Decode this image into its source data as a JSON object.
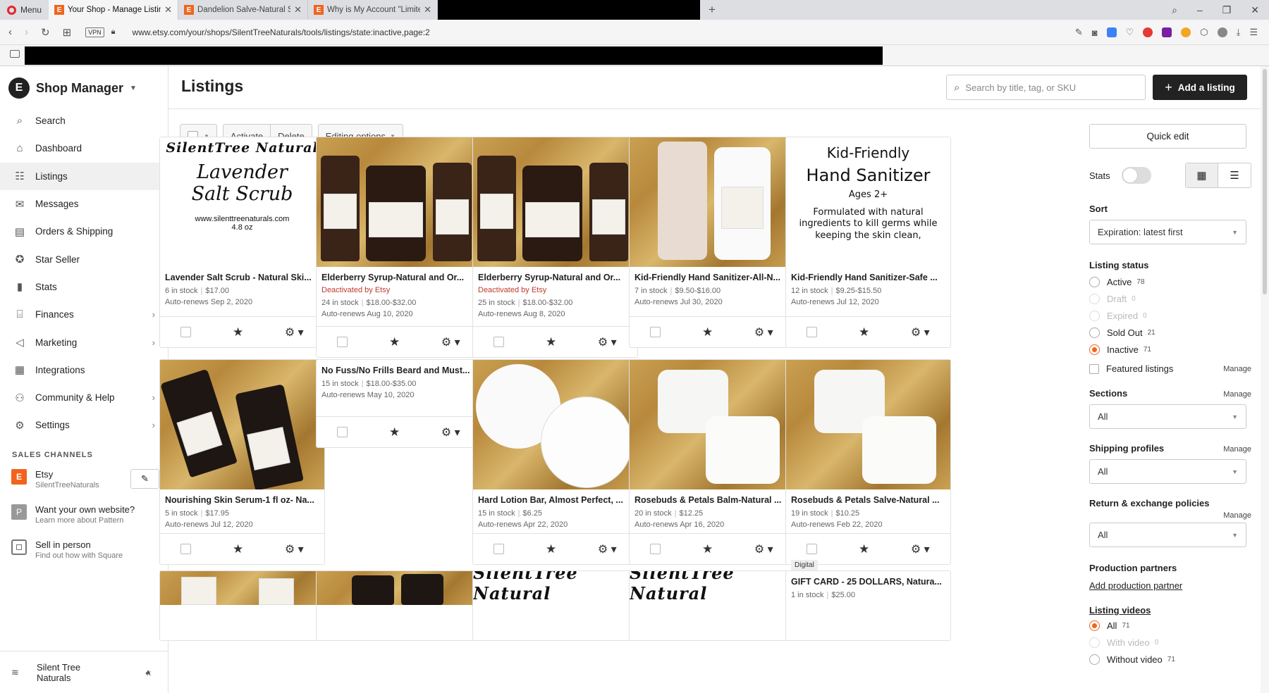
{
  "browser": {
    "menu_label": "Menu",
    "tabs": [
      {
        "title": "Your Shop - Manage Listing",
        "active": true
      },
      {
        "title": "Dandelion Salve-Natural St",
        "active": false
      },
      {
        "title": "Why is My Account \"Limited",
        "active": false
      }
    ],
    "url": "www.etsy.com/your/shops/SilentTreeNaturals/tools/listings/state:inactive,page:2",
    "vpn": "VPN"
  },
  "sidebar": {
    "title": "Shop Manager",
    "items": [
      {
        "label": "Search",
        "icon": "search-icon",
        "chev": false
      },
      {
        "label": "Dashboard",
        "icon": "home-icon",
        "chev": false
      },
      {
        "label": "Listings",
        "icon": "listings-icon",
        "chev": false,
        "active": true
      },
      {
        "label": "Messages",
        "icon": "mail-icon",
        "chev": false
      },
      {
        "label": "Orders & Shipping",
        "icon": "clipboard-icon",
        "chev": false
      },
      {
        "label": "Star Seller",
        "icon": "star-badge-icon",
        "chev": false
      },
      {
        "label": "Stats",
        "icon": "bar-chart-icon",
        "chev": false
      },
      {
        "label": "Finances",
        "icon": "bank-icon",
        "chev": true
      },
      {
        "label": "Marketing",
        "icon": "megaphone-icon",
        "chev": true
      },
      {
        "label": "Integrations",
        "icon": "grid-icon",
        "chev": false
      },
      {
        "label": "Community & Help",
        "icon": "people-icon",
        "chev": true
      },
      {
        "label": "Settings",
        "icon": "gear-icon",
        "chev": true
      }
    ],
    "sales_channels_title": "SALES CHANNELS",
    "channels": [
      {
        "name": "Etsy",
        "sub": "SilentTreeNaturals"
      },
      {
        "name": "Want your own website?",
        "sub": "Learn more about Pattern"
      },
      {
        "name": "Sell in person",
        "sub": "Find out how with Square"
      }
    ],
    "shop_name_line1": "Silent Tree",
    "shop_name_line2": "Naturals"
  },
  "header": {
    "title": "Listings",
    "search_placeholder": "Search by title, tag, or SKU",
    "add_label": "Add a listing"
  },
  "toolbar": {
    "activate": "Activate",
    "delete": "Delete",
    "editing": "Editing options"
  },
  "listings": [
    {
      "name": "Lavender Salt Scrub - Natural Ski...",
      "stock": "6 in stock",
      "price": "$17.00",
      "renew": "Auto-renews Sep 2, 2020",
      "deactivated": "",
      "img": "text",
      "img_lines": [
        "SilentTree Natural",
        "Lavender",
        "Salt Scrub",
        "www.silenttreenaturals.com",
        "4.8 oz"
      ]
    },
    {
      "name": "Elderberry Syrup-Natural and Or...",
      "stock": "24 in stock",
      "price": "$18.00-$32.00",
      "renew": "Auto-renews Aug 10, 2020",
      "deactivated": "Deactivated by Etsy",
      "img": "syrup"
    },
    {
      "name": "Elderberry Syrup-Natural and Or...",
      "stock": "25 in stock",
      "price": "$18.00-$32.00",
      "renew": "Auto-renews Aug 8, 2020",
      "deactivated": "Deactivated by Etsy",
      "img": "syrup"
    },
    {
      "name": "Kid-Friendly Hand Sanitizer-All-N...",
      "stock": "7 in stock",
      "price": "$9.50-$16.00",
      "renew": "Auto-renews Jul 30, 2020",
      "deactivated": "",
      "img": "sanitizer"
    },
    {
      "name": "Kid-Friendly Hand Sanitizer-Safe ...",
      "stock": "12 in stock",
      "price": "$9.25-$15.50",
      "renew": "Auto-renews Jul 12, 2020",
      "deactivated": "",
      "img": "text2",
      "img_lines": [
        "Kid-Friendly",
        "Hand Sanitizer",
        "Ages 2+",
        "Formulated with natural ingredients to kill germs while keeping the skin clean,"
      ]
    },
    {
      "name": "Nourishing Skin Serum-1 fl oz- Na...",
      "stock": "5 in stock",
      "price": "$17.95",
      "renew": "Auto-renews Jul 12, 2020",
      "deactivated": "",
      "img": "serum"
    },
    {
      "name": "No Fuss/No Frills Beard and Must...",
      "stock": "15 in stock",
      "price": "$18.00-$35.00",
      "renew": "Auto-renews May 10, 2020",
      "deactivated": "",
      "img": "none"
    },
    {
      "name": "Hard Lotion Bar, Almost Perfect, ...",
      "stock": "15 in stock",
      "price": "$6.25",
      "renew": "Auto-renews Apr 22, 2020",
      "deactivated": "",
      "img": "tins"
    },
    {
      "name": "Rosebuds & Petals Balm-Natural ...",
      "stock": "20 in stock",
      "price": "$12.25",
      "renew": "Auto-renews Apr 16, 2020",
      "deactivated": "",
      "img": "jars"
    },
    {
      "name": "Rosebuds & Petals Salve-Natural ...",
      "stock": "19 in stock",
      "price": "$10.25",
      "renew": "Auto-renews Feb 22, 2020",
      "deactivated": "",
      "img": "jars"
    },
    {
      "name": "",
      "img": "partial-straw"
    },
    {
      "name": "",
      "img": "partial-dark"
    },
    {
      "name": "",
      "img": "partial-text",
      "img_lines": [
        "SilentTree Natural"
      ]
    },
    {
      "name": "",
      "img": "partial-text",
      "img_lines": [
        "SilentTree Natural"
      ]
    },
    {
      "name": "GIFT CARD - 25 DOLLARS, Natura...",
      "stock": "1 in stock",
      "price": "$25.00",
      "img": "gift",
      "badge": "Digital"
    }
  ],
  "panel": {
    "quick_edit": "Quick edit",
    "stats_label": "Stats",
    "sort_title": "Sort",
    "sort_value": "Expiration: latest first",
    "status_title": "Listing status",
    "statuses": [
      {
        "label": "Active",
        "count": "78",
        "disabled": false,
        "on": false
      },
      {
        "label": "Draft",
        "count": "0",
        "disabled": true,
        "on": false
      },
      {
        "label": "Expired",
        "count": "0",
        "disabled": true,
        "on": false
      },
      {
        "label": "Sold Out",
        "count": "21",
        "disabled": false,
        "on": false
      },
      {
        "label": "Inactive",
        "count": "71",
        "disabled": false,
        "on": true
      }
    ],
    "featured": "Featured listings",
    "manage": "Manage",
    "sections_title": "Sections",
    "sections_value": "All",
    "shipping_title": "Shipping profiles",
    "shipping_value": "All",
    "returns_title": "Return & exchange policies",
    "returns_value": "All",
    "production_title": "Production partners",
    "production_link": "Add production partner",
    "videos_title": "Listing videos",
    "videos": [
      {
        "label": "All",
        "count": "71",
        "on": true,
        "disabled": false
      },
      {
        "label": "With video",
        "count": "0",
        "on": false,
        "disabled": true
      },
      {
        "label": "Without video",
        "count": "71",
        "on": false,
        "disabled": false
      }
    ]
  }
}
